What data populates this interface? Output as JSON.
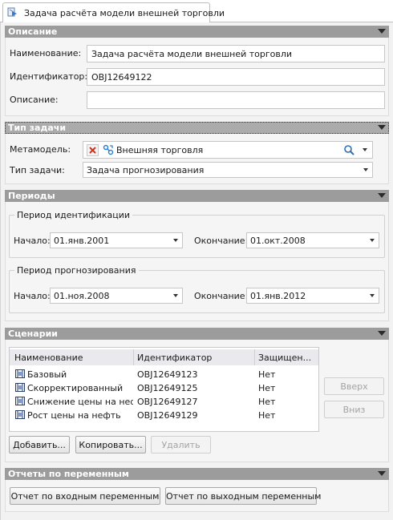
{
  "tab": {
    "icon": "task-icon",
    "title": "Задача расчёта модели внешней торговли"
  },
  "description": {
    "header": "Описание",
    "name_label": "Наименование:",
    "name_value": "Задача расчёта модели внешней торговли",
    "id_label": "Идентификатор:",
    "id_value": "OBJ12649122",
    "desc_label": "Описание:",
    "desc_value": ""
  },
  "task_type": {
    "header": "Тип задачи",
    "metamodel_label": "Метамодель:",
    "metamodel_value": "Внешняя торговля",
    "type_label": "Тип задачи:",
    "type_value": "Задача прогнозирования"
  },
  "periods": {
    "header": "Периоды",
    "ident": {
      "legend": "Период идентификации",
      "start_label": "Начало:",
      "start_value": "01.янв.2001",
      "end_label": "Окончание:",
      "end_value": "01.окт.2008"
    },
    "forecast": {
      "legend": "Период прогнозирования",
      "start_label": "Начало:",
      "start_value": "01.ноя.2008",
      "end_label": "Окончание:",
      "end_value": "01.янв.2012"
    }
  },
  "scenarios": {
    "header": "Сценарии",
    "columns": [
      "Наименование",
      "Идентификатор",
      "Защищен..."
    ],
    "rows": [
      {
        "name": "Базовый",
        "id": "OBJ12649123",
        "protected": "Нет"
      },
      {
        "name": "Скорректированный",
        "id": "OBJ12649125",
        "protected": "Нет"
      },
      {
        "name": "Снижение цены на нефть",
        "id": "OBJ12649127",
        "protected": "Нет"
      },
      {
        "name": "Рост цены на нефть",
        "id": "OBJ12649129",
        "protected": "Нет"
      }
    ],
    "up_label": "Вверх",
    "down_label": "Вниз",
    "add_label": "Добавить...",
    "copy_label": "Копировать...",
    "delete_label": "Удалить"
  },
  "reports": {
    "header": "Отчеты по переменным",
    "input_label": "Отчет по входным переменным",
    "output_label": "Отчет по выходным переменным"
  },
  "colors": {
    "section_header": "#9c9c9c",
    "panel_bg": "#f2f2f2",
    "clear_icon": "#d0331b",
    "link_icon": "#2a7fd4"
  }
}
